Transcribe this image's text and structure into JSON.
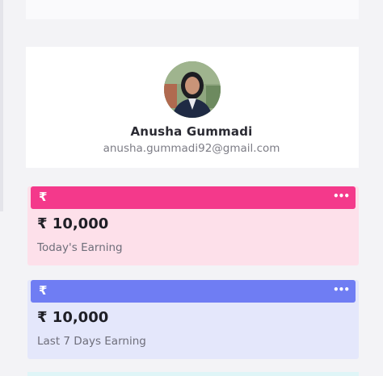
{
  "profile": {
    "name": "Anusha Gummadi",
    "email": "anusha.gummadi92@gmail.com"
  },
  "cards": [
    {
      "icon": "rupee-icon",
      "icon_glyph": "₹",
      "menu_icon": "more-horizontal-icon",
      "menu_glyph": "•••",
      "amount": "₹ 10,000",
      "label": "Today's Earning",
      "accent": "#f4398b",
      "background": "#fde0ea"
    },
    {
      "icon": "rupee-icon",
      "icon_glyph": "₹",
      "menu_icon": "more-horizontal-icon",
      "menu_glyph": "•••",
      "amount": "₹ 10,000",
      "label": "Last 7 Days Earning",
      "accent": "#6f7df3",
      "background": "#e4e7fb"
    }
  ]
}
